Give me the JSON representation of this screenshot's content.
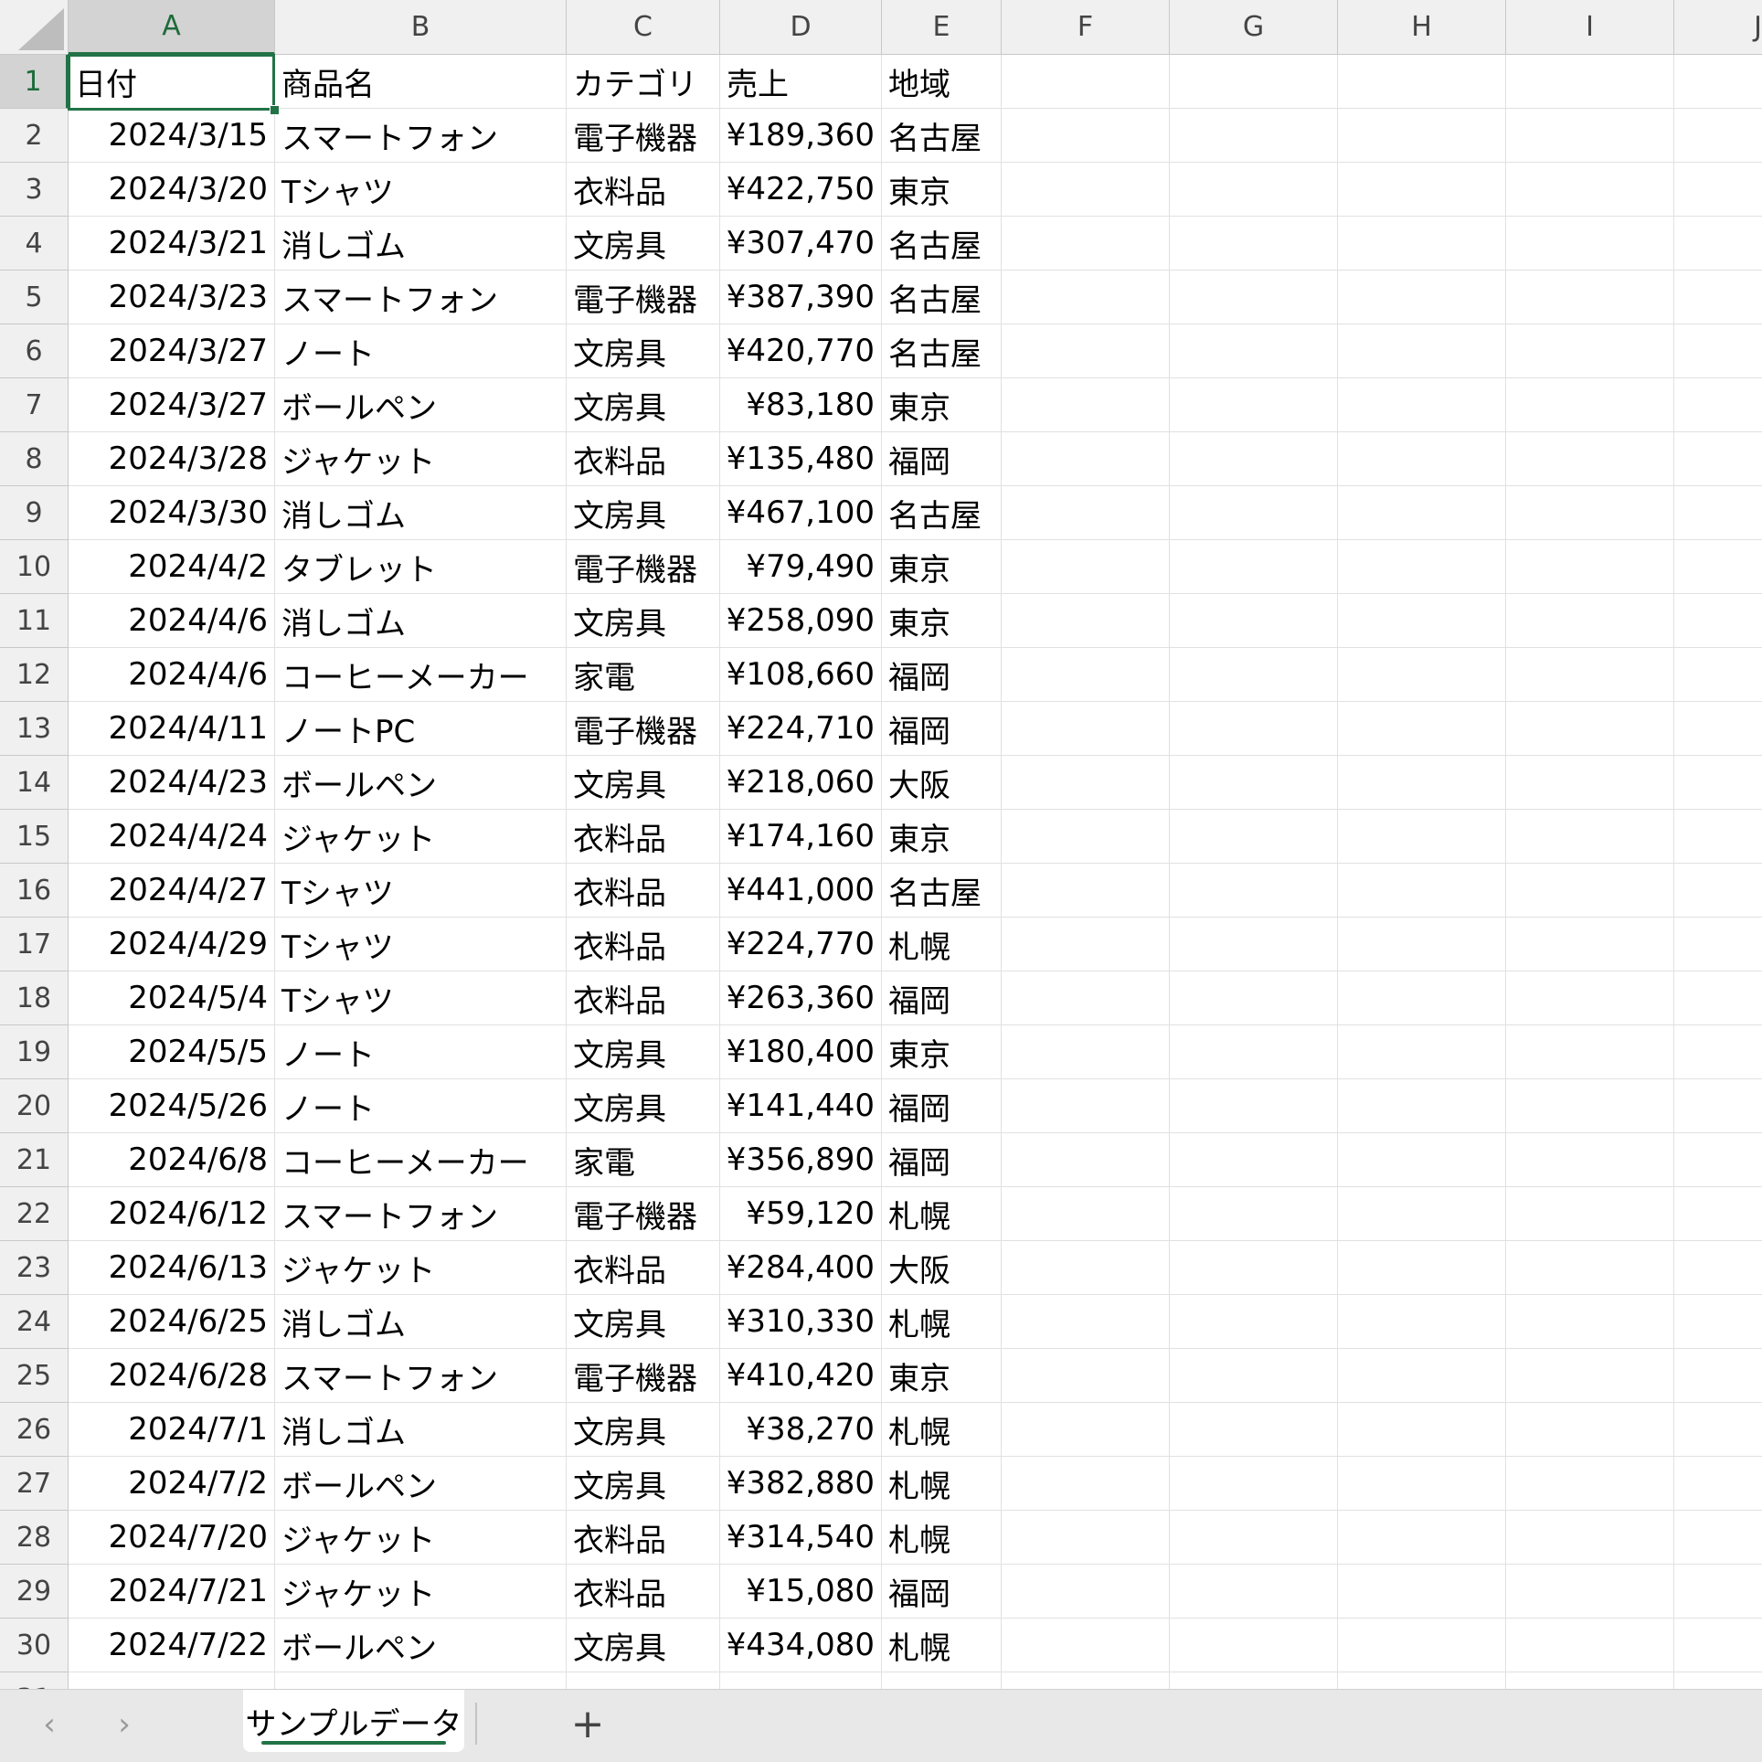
{
  "grid": {
    "columns": [
      "A",
      "B",
      "C",
      "D",
      "E",
      "F",
      "G",
      "H",
      "I",
      "J"
    ],
    "header": [
      "日付",
      "商品名",
      "カテゴリ",
      "売上",
      "地域"
    ],
    "rows": [
      [
        "2024/3/15",
        "スマートフォン",
        "電子機器",
        "¥189,360",
        "名古屋"
      ],
      [
        "2024/3/20",
        "Tシャツ",
        "衣料品",
        "¥422,750",
        "東京"
      ],
      [
        "2024/3/21",
        "消しゴム",
        "文房具",
        "¥307,470",
        "名古屋"
      ],
      [
        "2024/3/23",
        "スマートフォン",
        "電子機器",
        "¥387,390",
        "名古屋"
      ],
      [
        "2024/3/27",
        "ノート",
        "文房具",
        "¥420,770",
        "名古屋"
      ],
      [
        "2024/3/27",
        "ボールペン",
        "文房具",
        "¥83,180",
        "東京"
      ],
      [
        "2024/3/28",
        "ジャケット",
        "衣料品",
        "¥135,480",
        "福岡"
      ],
      [
        "2024/3/30",
        "消しゴム",
        "文房具",
        "¥467,100",
        "名古屋"
      ],
      [
        "2024/4/2",
        "タブレット",
        "電子機器",
        "¥79,490",
        "東京"
      ],
      [
        "2024/4/6",
        "消しゴム",
        "文房具",
        "¥258,090",
        "東京"
      ],
      [
        "2024/4/6",
        "コーヒーメーカー",
        "家電",
        "¥108,660",
        "福岡"
      ],
      [
        "2024/4/11",
        "ノートPC",
        "電子機器",
        "¥224,710",
        "福岡"
      ],
      [
        "2024/4/23",
        "ボールペン",
        "文房具",
        "¥218,060",
        "大阪"
      ],
      [
        "2024/4/24",
        "ジャケット",
        "衣料品",
        "¥174,160",
        "東京"
      ],
      [
        "2024/4/27",
        "Tシャツ",
        "衣料品",
        "¥441,000",
        "名古屋"
      ],
      [
        "2024/4/29",
        "Tシャツ",
        "衣料品",
        "¥224,770",
        "札幌"
      ],
      [
        "2024/5/4",
        "Tシャツ",
        "衣料品",
        "¥263,360",
        "福岡"
      ],
      [
        "2024/5/5",
        "ノート",
        "文房具",
        "¥180,400",
        "東京"
      ],
      [
        "2024/5/26",
        "ノート",
        "文房具",
        "¥141,440",
        "福岡"
      ],
      [
        "2024/6/8",
        "コーヒーメーカー",
        "家電",
        "¥356,890",
        "福岡"
      ],
      [
        "2024/6/12",
        "スマートフォン",
        "電子機器",
        "¥59,120",
        "札幌"
      ],
      [
        "2024/6/13",
        "ジャケット",
        "衣料品",
        "¥284,400",
        "大阪"
      ],
      [
        "2024/6/25",
        "消しゴム",
        "文房具",
        "¥310,330",
        "札幌"
      ],
      [
        "2024/6/28",
        "スマートフォン",
        "電子機器",
        "¥410,420",
        "東京"
      ],
      [
        "2024/7/1",
        "消しゴム",
        "文房具",
        "¥38,270",
        "札幌"
      ],
      [
        "2024/7/2",
        "ボールペン",
        "文房具",
        "¥382,880",
        "札幌"
      ],
      [
        "2024/7/20",
        "ジャケット",
        "衣料品",
        "¥314,540",
        "札幌"
      ],
      [
        "2024/7/21",
        "ジャケット",
        "衣料品",
        "¥15,080",
        "福岡"
      ],
      [
        "2024/7/22",
        "ボールペン",
        "文房具",
        "¥434,080",
        "札幌"
      ]
    ],
    "active_cell": "A1"
  },
  "tabs": {
    "sheets": [
      "サンプルデータ"
    ],
    "prev_icon": "chevron-left-icon",
    "next_icon": "chevron-right-icon",
    "add_icon": "plus-icon"
  }
}
